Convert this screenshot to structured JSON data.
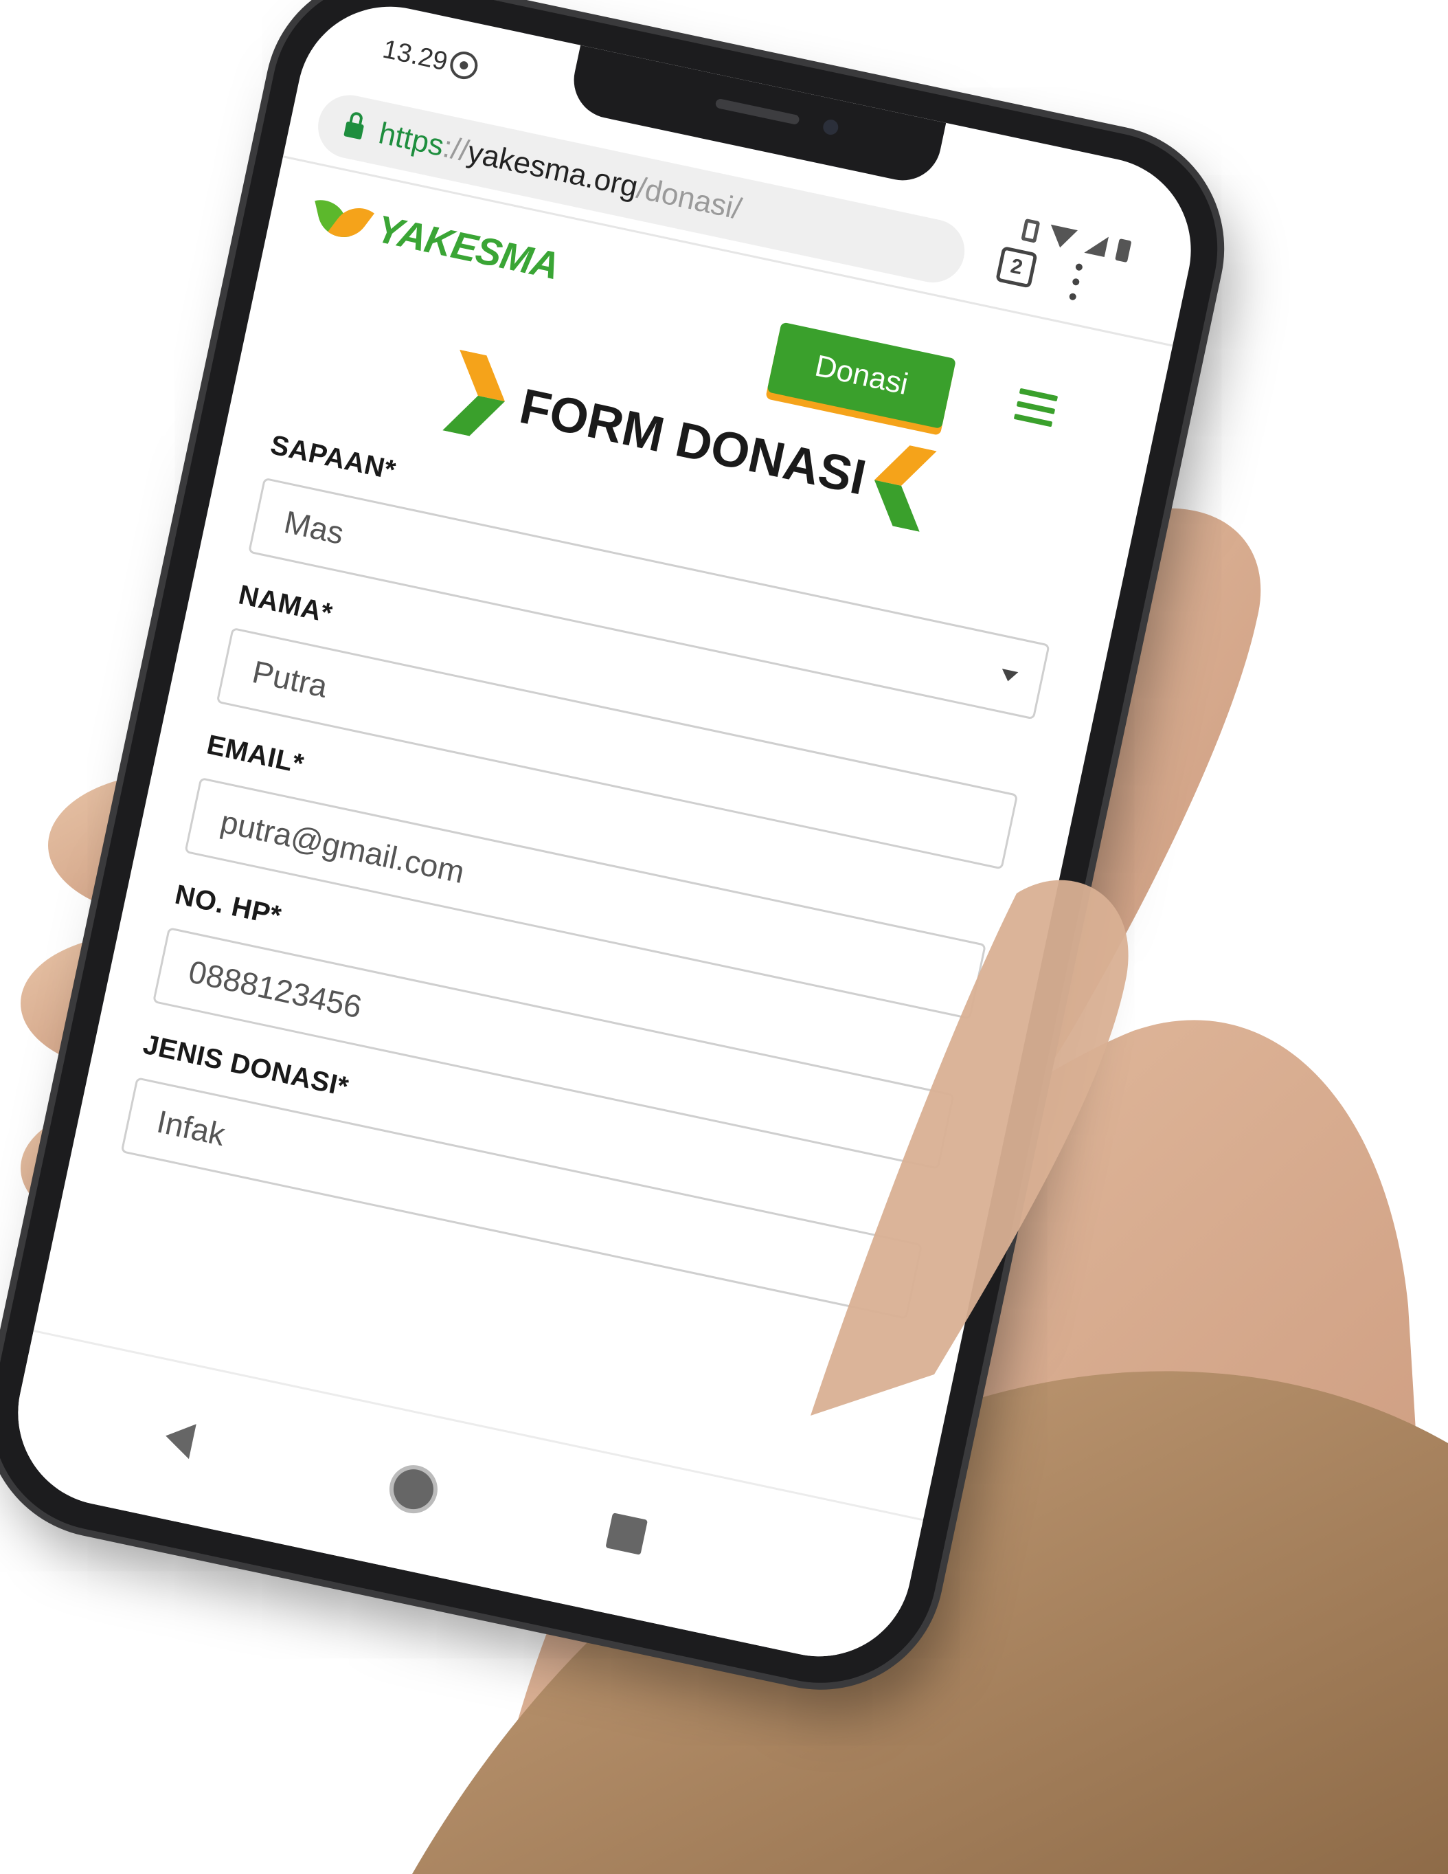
{
  "status_bar": {
    "time": "13.29",
    "icons": [
      "whatsapp-icon",
      "vibrate-icon",
      "wifi-icon",
      "signal-icon",
      "battery-icon"
    ]
  },
  "browser": {
    "url_scheme": "https",
    "url_separator": "://",
    "url_host": "yakesma.org",
    "url_path": "/donasi/",
    "tab_count": "2",
    "secure_color": "#1e8e3e"
  },
  "site": {
    "logo_text": "YAKESMA",
    "donate_button": "Donasi",
    "brand_green": "#3aa02c",
    "brand_orange": "#f5a31a"
  },
  "form": {
    "title": "FORM DONASI",
    "fields": [
      {
        "label": "SAPAAN*",
        "value": "Mas",
        "type": "select"
      },
      {
        "label": "NAMA*",
        "value": "Putra",
        "type": "text"
      },
      {
        "label": "EMAIL*",
        "value": "putra@gmail.com",
        "type": "email"
      },
      {
        "label": "NO. HP*",
        "value": "0888123456",
        "type": "tel"
      },
      {
        "label": "JENIS DONASI*",
        "value": "Infak",
        "type": "select"
      }
    ]
  },
  "navigation": {
    "icons": [
      "back-icon",
      "home-icon",
      "recents-icon"
    ]
  }
}
